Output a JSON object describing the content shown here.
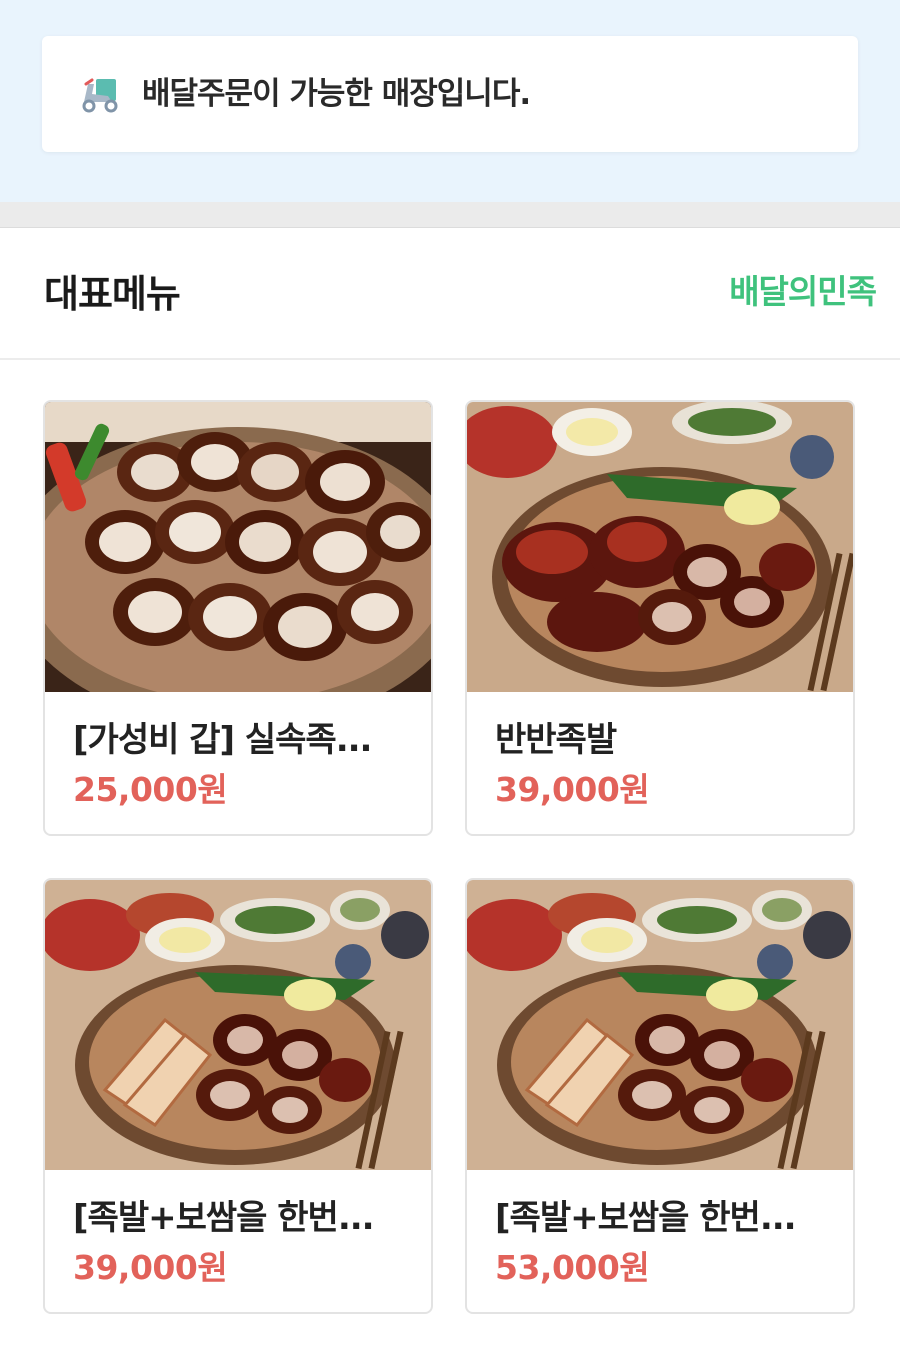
{
  "notice": {
    "icon": "delivery-scooter-icon",
    "text": "배달주문이 가능한 매장입니다."
  },
  "section": {
    "title": "대표메뉴",
    "brand": "배달의민족"
  },
  "menu": [
    {
      "name": "[가성비 갑] 실속족...",
      "price": "25,000원",
      "photo": "sliced-jokbal-platter"
    },
    {
      "name": "반반족발",
      "price": "39,000원",
      "photo": "half-half-jokbal-platter"
    },
    {
      "name": "[족발+보쌈을 한번...",
      "price": "39,000원",
      "photo": "jokbal-bossam-platter"
    },
    {
      "name": "[족발+보쌈을 한번...",
      "price": "53,000원",
      "photo": "jokbal-bossam-platter"
    }
  ],
  "colors": {
    "accent_green": "#3fc27d",
    "price_red": "#e2625a",
    "top_bg": "#e9f4fd"
  }
}
